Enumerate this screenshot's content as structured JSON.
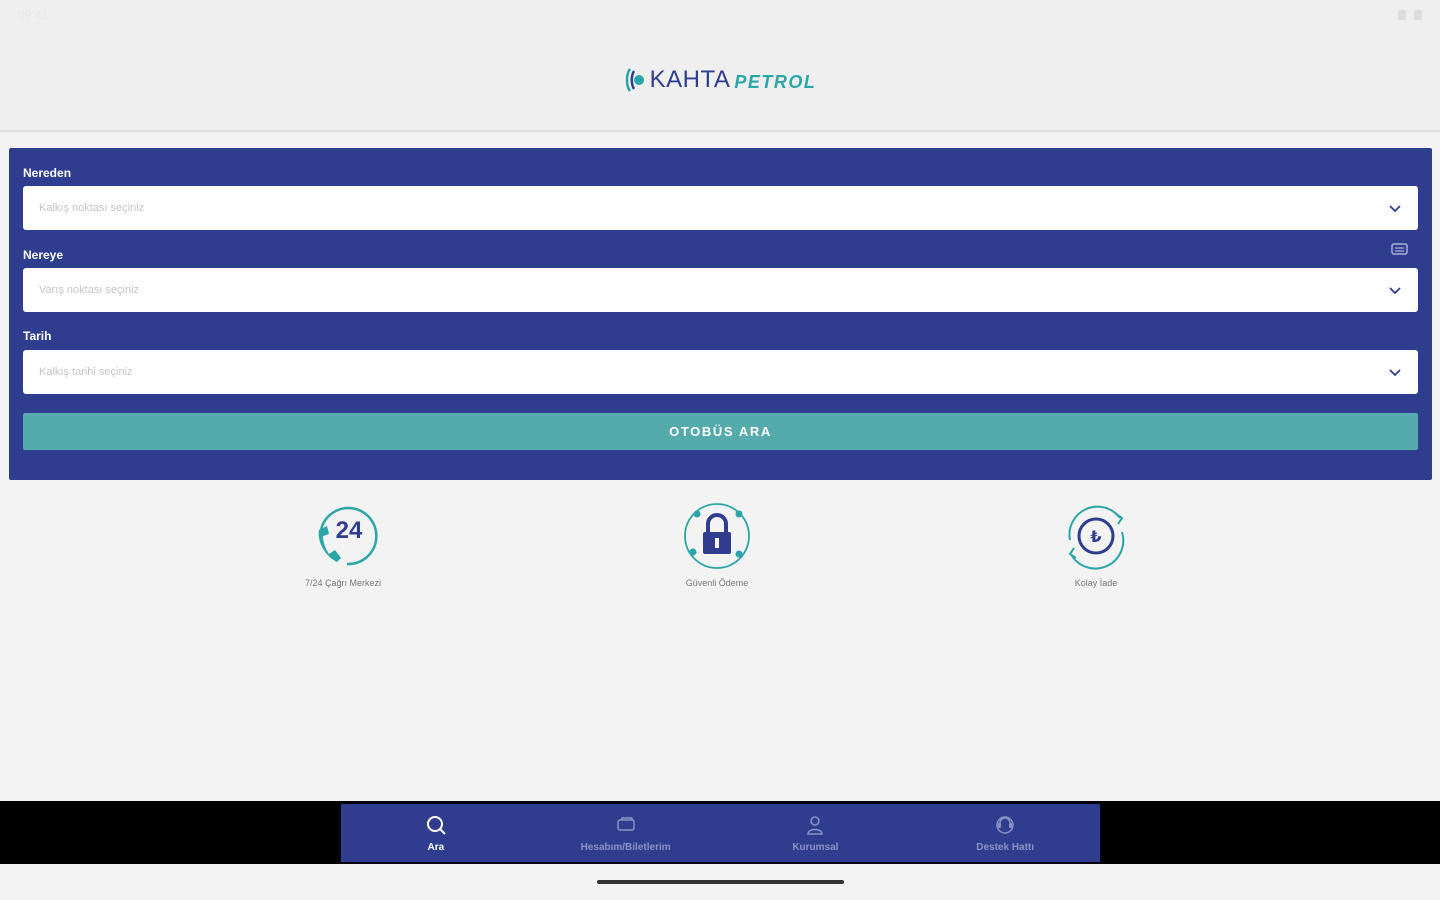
{
  "status_bar": {
    "time": "09:41"
  },
  "header": {
    "logo_text_main": "KAHTA",
    "logo_text_sub": "PETROL"
  },
  "search": {
    "from_label": "Nereden",
    "from_placeholder": "Kalkış noktası seçiniz",
    "to_label": "Nereye",
    "to_placeholder": "Varış noktası seçiniz",
    "date_label": "Tarih",
    "date_placeholder": "Kalkış tarihi seçiniz",
    "button_label": "OTOBÜS ARA"
  },
  "features": [
    {
      "icon": "phone-24-icon",
      "caption": "7/24 Çağrı Merkezi",
      "badge": "24"
    },
    {
      "icon": "lock-icon",
      "caption": "Güvenli Ödeme"
    },
    {
      "icon": "refund-icon",
      "caption": "Kolay İade"
    }
  ],
  "nav": [
    {
      "icon": "search-icon",
      "label": "Ara",
      "active": true
    },
    {
      "icon": "ticket-icon",
      "label": "Hesabım/Biletlerim",
      "active": false
    },
    {
      "icon": "user-icon",
      "label": "Kurumsal",
      "active": false
    },
    {
      "icon": "support-icon",
      "label": "Destek Hattı",
      "active": false
    }
  ],
  "colors": {
    "primary": "#2f3d8f",
    "accent": "#55aaab",
    "teal": "#2aa5a8"
  }
}
